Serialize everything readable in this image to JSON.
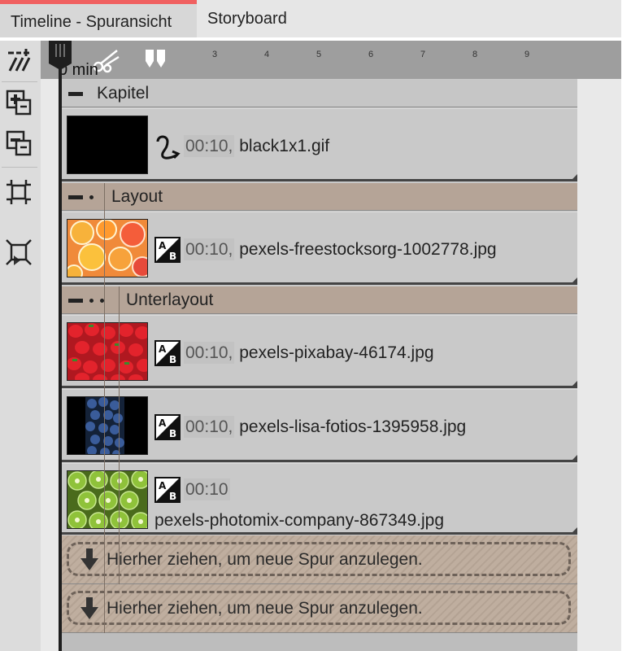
{
  "tabs": [
    {
      "label": "Timeline - Spuransicht",
      "active": true
    },
    {
      "label": "Storyboard",
      "active": false
    }
  ],
  "colors": {
    "accent": "#f06060",
    "chapter_gray": "#c6c6c6",
    "chapter_tan": "#b5a497"
  },
  "toolbar": {
    "icons": [
      "tracks-toggle-icon",
      "add-track-icon",
      "remove-track-icon",
      "collapse-all-icon",
      "expand-all-icon"
    ]
  },
  "ruler": {
    "zero_label": "0 min",
    "numbers": [
      "3",
      "4",
      "5",
      "6",
      "7",
      "8",
      "9"
    ]
  },
  "chapters": [
    {
      "label": "Kapitel",
      "level": 0
    },
    {
      "label": "Layout",
      "level": 1
    },
    {
      "label": "Unterlayout",
      "level": 2
    }
  ],
  "clips": [
    {
      "time": "00:10,",
      "name": "black1x1.gif",
      "icon": "curve-transition-icon",
      "thumb": "black"
    },
    {
      "time": "00:10,",
      "name": "pexels-freestocksorg-1002778.jpg",
      "icon": "ab-transition-icon",
      "thumb": "oranges"
    },
    {
      "time": "00:10,",
      "name": "pexels-pixabay-46174.jpg",
      "icon": "ab-transition-icon",
      "thumb": "strawberries"
    },
    {
      "time": "00:10,",
      "name": "pexels-lisa-fotios-1395958.jpg",
      "icon": "ab-transition-icon",
      "thumb": "blueberries"
    },
    {
      "time": "00:10",
      "name": "pexels-photomix-company-867349.jpg",
      "icon": "ab-transition-icon",
      "thumb": "kiwis"
    }
  ],
  "drop_zones": [
    {
      "label": "Hierher ziehen, um neue Spur anzulegen."
    },
    {
      "label": "Hierher ziehen, um neue Spur anzulegen."
    }
  ]
}
